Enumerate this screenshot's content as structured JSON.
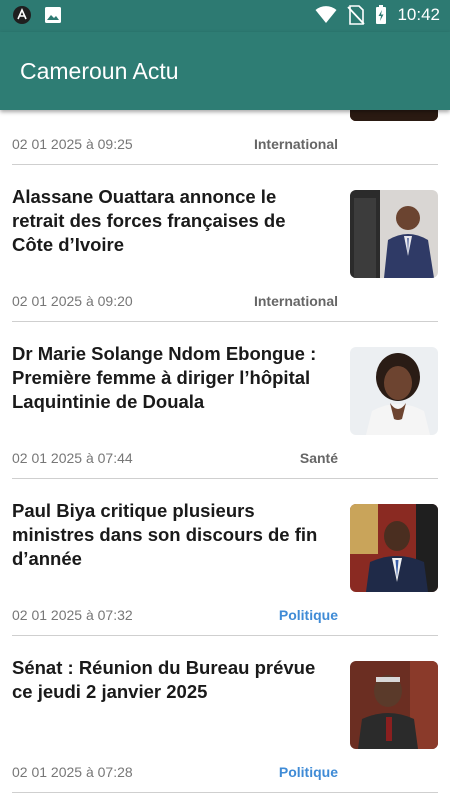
{
  "status": {
    "time": "10:42"
  },
  "app": {
    "title": "Cameroun Actu"
  },
  "articles": [
    {
      "title": "",
      "date": "02 01 2025 à 09:25",
      "category": "International",
      "thumb": "crowd"
    },
    {
      "title": "Alassane Ouattara annonce le retrait des forces françaises de Côte d’Ivoire",
      "date": "02 01 2025 à 09:20",
      "category": "International",
      "thumb": "man-suit"
    },
    {
      "title": "Dr Marie Solange Ndom Ebongue : Première femme à diriger  l’hôpital Laquintinie de Douala",
      "date": "02 01 2025 à 07:44",
      "category": "Santé",
      "thumb": "woman-portrait"
    },
    {
      "title": "Paul Biya critique plusieurs ministres dans son discours de fin d’année",
      "date": "02 01 2025 à 07:32",
      "category": "Politique",
      "thumb": "president"
    },
    {
      "title": "Sénat : Réunion du Bureau prévue ce jeudi 2 janvier 2025",
      "date": "02 01 2025 à 07:28",
      "category": "Politique",
      "thumb": "elder"
    }
  ]
}
